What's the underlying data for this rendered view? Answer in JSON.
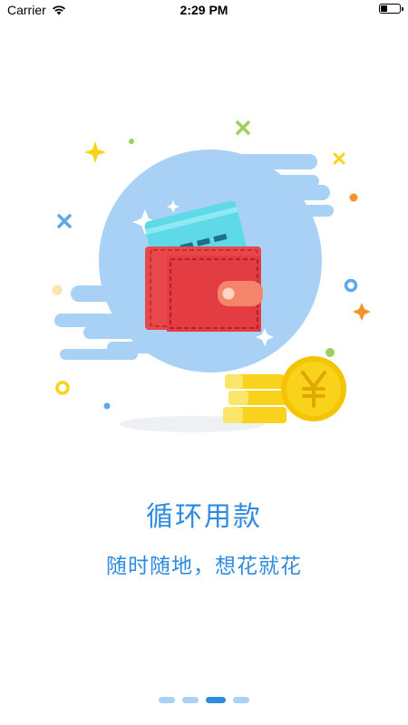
{
  "status_bar": {
    "carrier": "Carrier",
    "time": "2:29 PM",
    "battery_level": 0.35
  },
  "onboarding": {
    "title": "循环用款",
    "subtitle": "随时随地，想花就花",
    "illustration_icons": [
      "wallet-icon",
      "bank-card-icon",
      "yen-coin-icon"
    ],
    "colors": {
      "accent": "#2f8be0",
      "blob": "#a9d1f5",
      "wallet": "#e8474c",
      "card": "#5fd9e8",
      "coin": "#f8d21b"
    }
  },
  "pagination": {
    "total": 4,
    "active_index": 2
  }
}
